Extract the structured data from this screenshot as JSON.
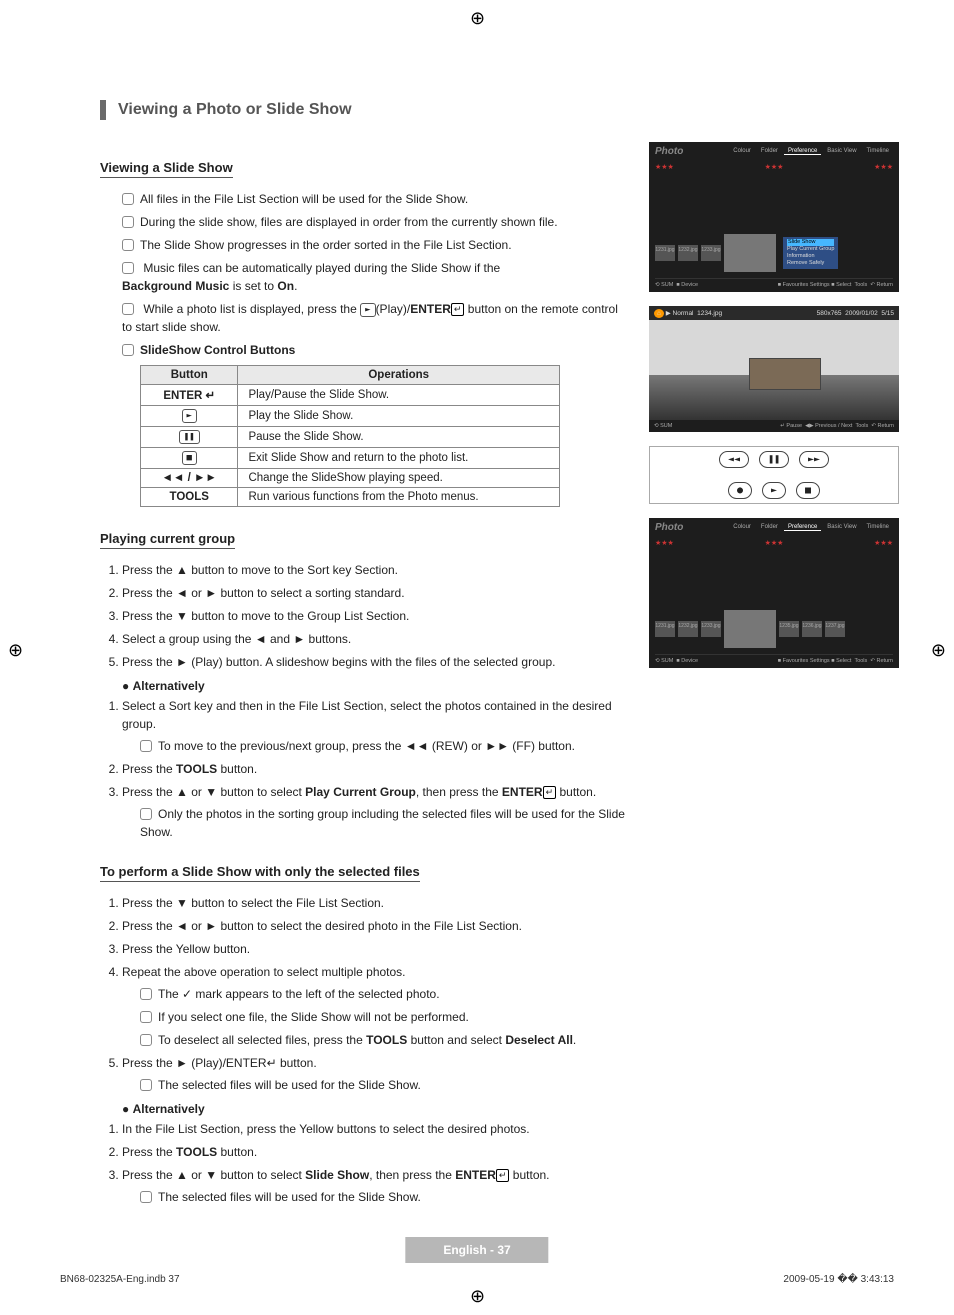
{
  "header_title": "Viewing a Photo or Slide Show",
  "section_viewing": "Viewing a Slide Show",
  "notes_viewing": [
    "All files in the File List Section will be used for the Slide Show.",
    "During the slide show, files are displayed in order from the currently shown file.",
    "The Slide Show progresses in the order sorted in the File List Section.",
    "Music files can be automatically played during the Slide Show if the",
    "While a photo list is displayed, press the",
    "SlideShow Control Buttons"
  ],
  "bg_music_text": "Background Music",
  "is_set_to": " is set to ",
  "on_text": "On",
  "press_play_enter_suffix": " button on the remote control to start slide show.",
  "play_label": "(Play)/",
  "enter_label": "ENTER",
  "table": {
    "h1": "Button",
    "h2": "Operations",
    "rows": [
      {
        "b": "ENTER ↵",
        "op": "Play/Pause the Slide Show."
      },
      {
        "b": "►",
        "op": "Play the Slide Show."
      },
      {
        "b": "❚❚",
        "op": "Pause the Slide Show."
      },
      {
        "b": "■",
        "op": "Exit Slide Show and return to the photo list."
      },
      {
        "b": "◄◄ / ►►",
        "op": "Change the SlideShow playing speed."
      },
      {
        "b": "TOOLS",
        "op": "Run various functions from the Photo menus."
      }
    ]
  },
  "section_playing": "Playing current group",
  "steps_playing": [
    "Press the ▲ button to move to the Sort key Section.",
    "Press the ◄ or ► button to select a sorting standard.",
    "Press the ▼ button to move to the Group List Section.",
    "Select a group using the ◄ and ► buttons.",
    "Press the  ►  (Play) button.  A slideshow begins with the files of the selected group."
  ],
  "alt_label": "Alternatively",
  "alt1_steps": [
    "Select a Sort key and then in the File List Section, select the photos contained in the desired group.",
    "Press the TOOLS button.",
    "Press the ▲ or ▼ button to select Play Current Group, then press the ENTER↵ button."
  ],
  "alt1_sub1": "To move to the previous/next group, press the  ◄◄  (REW) or  ►►  (FF) button.",
  "alt1_sub_only": "Only the photos in the sorting group including the selected files will be used for the Slide Show.",
  "section_selected": "To perform a Slide Show with only the selected files",
  "steps_selected": [
    "Press the ▼ button to select the File List Section.",
    "Press the ◄ or ► button to select the desired photo in the File List Section.",
    "Press the Yellow button.",
    "Repeat the above operation to select multiple photos.",
    "Press the  ►  (Play)/ENTER↵ button."
  ],
  "selected_subnotes": [
    "The  ✓  mark appears to the left of the selected photo.",
    "If you select one file, the Slide Show will not be performed.",
    "To deselect all selected files, press the TOOLS button and select Deselect All."
  ],
  "selected_after5": "The selected files will be used for the Slide Show.",
  "alt2_steps": [
    "In the File List Section, press the Yellow buttons to select the desired photos.",
    "Press the TOOLS button.",
    "Press the ▲ or ▼ button to select Slide Show, then press the ENTER↵ button."
  ],
  "alt2_sub": "The selected files will be used for the Slide Show.",
  "tools_b": "TOOLS",
  "play_current_group_b": "Play Current Group",
  "slide_show_b": "Slide Show",
  "deselect_all_b": "Deselect All",
  "mock": {
    "photo": "Photo",
    "tabs": [
      "Colour",
      "Folder",
      "Preference",
      "Basic View",
      "Timeline"
    ],
    "popup": {
      "top": "Slide Show",
      "items": [
        "Play Current Group",
        "Information",
        "Remove Safely"
      ]
    },
    "thumbs": [
      "1231.jpg",
      "1232.jpg",
      "1233.jpg",
      "1234.jpg",
      "1235.jpg",
      "1236.jpg",
      "1237.jpg"
    ],
    "footer": [
      "SUM",
      "Device",
      "Favourites Settings",
      "Select",
      "Tools",
      "Return"
    ],
    "player_top": [
      "▶ Normal",
      "1234.jpg",
      "580x765",
      "2009/01/02",
      "5/15"
    ],
    "player_bot": [
      "SUM",
      "↵ Pause",
      "◀▶ Previous / Next",
      "Tools",
      "Return"
    ]
  },
  "remote_buttons": [
    "◄◄",
    "❚❚",
    "►►",
    "●",
    "►",
    "■"
  ],
  "page_num": "English - 37",
  "foot_left": "BN68-02325A-Eng.indb   37",
  "foot_right": "2009-05-19   �� 3:43:13"
}
